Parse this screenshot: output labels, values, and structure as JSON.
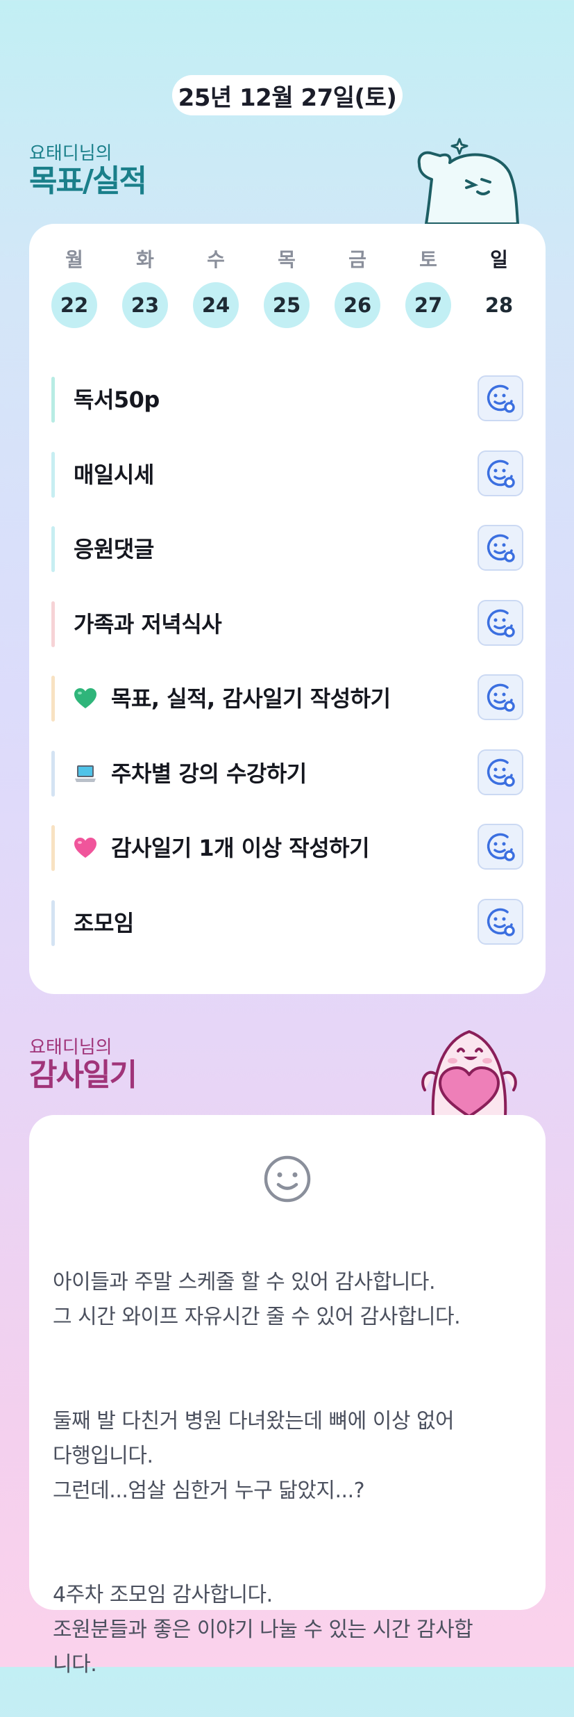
{
  "header": {
    "date": "25년 12월 27일(토)"
  },
  "goals_section": {
    "subtitle": "요태디님의",
    "title": "목표/실적",
    "week": [
      {
        "weekday": "월",
        "day": "22",
        "done": true
      },
      {
        "weekday": "화",
        "day": "23",
        "done": true
      },
      {
        "weekday": "수",
        "day": "24",
        "done": true
      },
      {
        "weekday": "목",
        "day": "25",
        "done": true
      },
      {
        "weekday": "금",
        "day": "26",
        "done": true
      },
      {
        "weekday": "토",
        "day": "27",
        "done": true
      },
      {
        "weekday": "일",
        "day": "28",
        "done": false
      }
    ],
    "goals": [
      {
        "label": "독서50p",
        "bar_color": "#b8ece4",
        "emoji": ""
      },
      {
        "label": "매일시세",
        "bar_color": "#c7eef2",
        "emoji": ""
      },
      {
        "label": "응원댓글",
        "bar_color": "#c7eef2",
        "emoji": ""
      },
      {
        "label": "가족과 저녁식사",
        "bar_color": "#f6d3d6",
        "emoji": ""
      },
      {
        "label": "목표, 실적, 감사일기 작성하기",
        "bar_color": "#f8e2c2",
        "emoji": "green-heart-icon"
      },
      {
        "label": "주차별 강의 수강하기",
        "bar_color": "#d4e3f3",
        "emoji": "laptop-icon"
      },
      {
        "label": "감사일기 1개 이상 작성하기",
        "bar_color": "#f8e2c2",
        "emoji": "pink-heart-icon"
      },
      {
        "label": "조모임",
        "bar_color": "#d4e3f3",
        "emoji": ""
      }
    ],
    "action_icon": "smile-add-icon"
  },
  "diary_section": {
    "subtitle": "요태디님의",
    "title": "감사일기",
    "mood_icon": "smile-face-icon",
    "paragraphs": [
      "아이들과 주말 스케줄 할 수 있어 감사합니다.\n그 시간 와이프 자유시간 줄 수 있어 감사합니다.",
      "둘째 발 다친거 병원 다녀왔는데 뼈에 이상 없어\n다행입니다.\n그런데...엄살 심한거 누구 닮았지...?",
      "4주차 조모임 감사합니다.\n조원분들과 좋은 이야기 나눌 수 있는 시간 감사합\n니다."
    ]
  },
  "colors": {
    "accent_teal": "#1a7f8a",
    "accent_magenta": "#a03479",
    "day_done_bg": "#c2eff4",
    "action_icon": "#3b6fe0"
  }
}
